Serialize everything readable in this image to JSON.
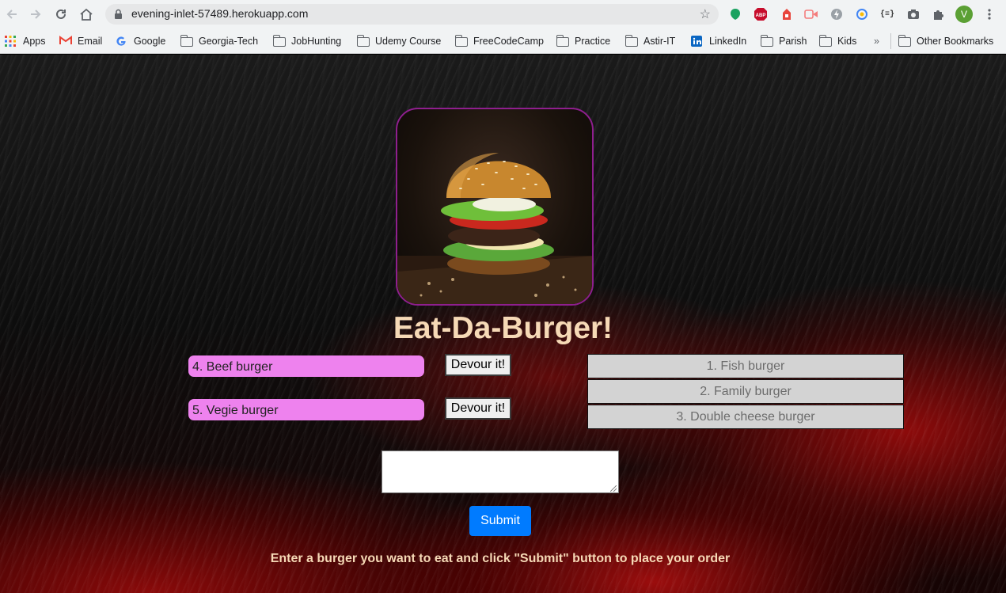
{
  "browser": {
    "url": "evening-inlet-57489.herokuapp.com",
    "bookmarks": [
      {
        "label": "Apps"
      },
      {
        "label": "Email"
      },
      {
        "label": "Google"
      },
      {
        "label": "Georgia-Tech"
      },
      {
        "label": "JobHunting"
      },
      {
        "label": "Udemy Course"
      },
      {
        "label": "FreeCodeCamp"
      },
      {
        "label": "Practice"
      },
      {
        "label": "Astir-IT"
      },
      {
        "label": "LinkedIn"
      },
      {
        "label": "Parish"
      },
      {
        "label": "Kids"
      }
    ],
    "overflow_label": "»",
    "other_bookmarks": "Other Bookmarks",
    "profile_initial": "V",
    "extensions": {
      "abp_label": "ABP",
      "json_label": "{≡}"
    }
  },
  "page": {
    "title": "Eat-Da-Burger!",
    "uneaten_burgers": [
      {
        "label": "4. Beef burger",
        "button": "Devour it!"
      },
      {
        "label": "5. Vegie burger",
        "button": "Devour it!"
      }
    ],
    "devoured_burgers": [
      {
        "label": "1. Fish burger"
      },
      {
        "label": "2. Family burger"
      },
      {
        "label": "3. Double cheese burger"
      }
    ],
    "burger_input": {
      "value": "",
      "placeholder": ""
    },
    "submit_label": "Submit",
    "hint": "Enter a burger you want to eat and click \"Submit\" button to place your order"
  },
  "colors": {
    "title": "#f6d9b6",
    "pill": "#ee82ee",
    "devoured_bg": "#d3d3d3",
    "submit": "#007bff",
    "image_border": "#8e1f8e"
  }
}
